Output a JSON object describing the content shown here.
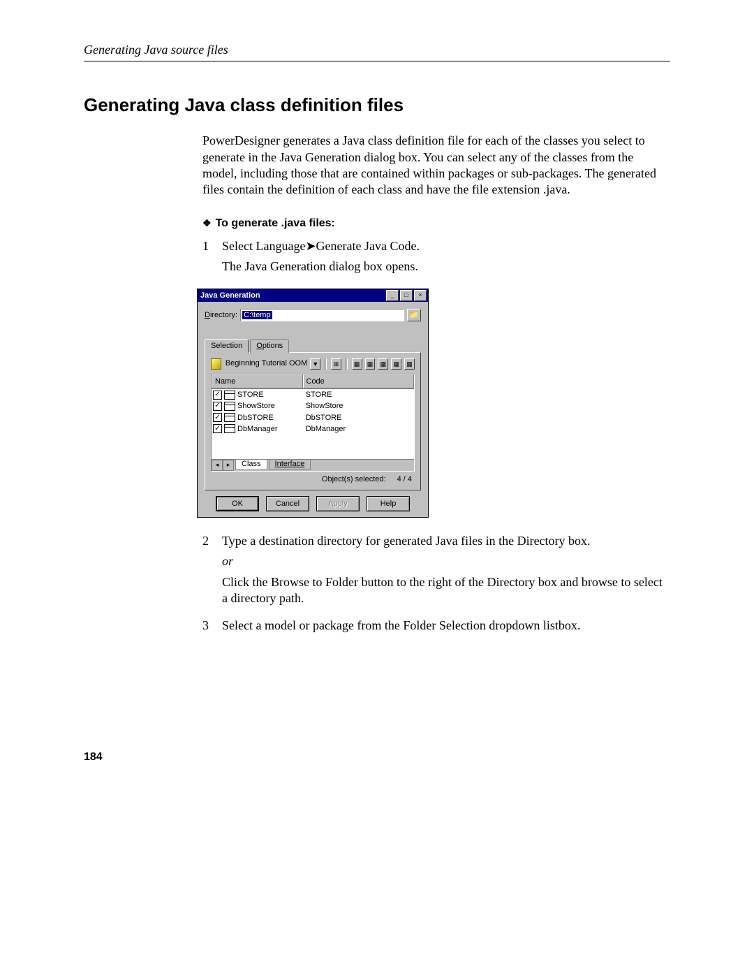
{
  "running_head": "Generating Java source files",
  "section_title": "Generating Java class definition files",
  "intro": "PowerDesigner generates a Java class definition file for each of the classes you select to generate in the Java Generation dialog box. You can select any of the classes from the model, including those that are contained within packages or sub-packages. The generated files contain the definition of each class and have the file extension .java.",
  "subhead": "To generate .java files:",
  "steps": {
    "s1": {
      "num": "1",
      "line1a": "Select Language",
      "line1b": "Generate Java Code.",
      "line2": "The Java Generation dialog box opens."
    },
    "s2": {
      "num": "2",
      "p1": "Type a destination directory for generated Java files in the Directory box.",
      "or": "or",
      "p2": "Click the Browse to Folder button to the right of the Directory box and browse to select a directory path."
    },
    "s3": {
      "num": "3",
      "p1": "Select a model or package from the Folder Selection dropdown listbox."
    }
  },
  "dialog": {
    "title": "Java Generation",
    "dir_label_pre": "D",
    "dir_label_rest": "irectory:",
    "dir_value": "C:\\temp",
    "tabs": {
      "selection": "Selection",
      "options_pre": "O",
      "options_rest": "ptions"
    },
    "model_name": "Beginning Tutorial OOM",
    "list": {
      "head_name": "Name",
      "head_code": "Code",
      "rows": [
        {
          "name": "STORE",
          "code": "STORE"
        },
        {
          "name": "ShowStore",
          "code": "ShowStore"
        },
        {
          "name": "DbSTORE",
          "code": "DbSTORE"
        },
        {
          "name": "DbManager",
          "code": "DbManager"
        }
      ]
    },
    "sheet_tabs": {
      "class": "Class",
      "interface": "Interface"
    },
    "status_label": "Object(s) selected:",
    "status_count": "4 / 4",
    "buttons": {
      "ok": "OK",
      "cancel": "Cancel",
      "apply": "Apply",
      "help": "Help"
    }
  },
  "page_number": "184"
}
